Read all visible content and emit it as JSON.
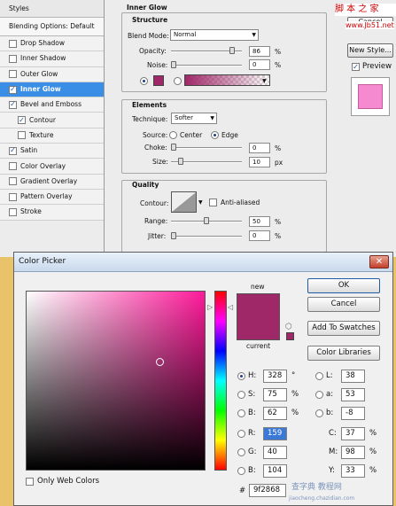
{
  "layer_style": {
    "header": "Styles",
    "blending_options": "Blending Options: Default",
    "items": [
      {
        "label": "Drop Shadow",
        "checked": false,
        "selected": false,
        "sub": false
      },
      {
        "label": "Inner Shadow",
        "checked": false,
        "selected": false,
        "sub": false
      },
      {
        "label": "Outer Glow",
        "checked": false,
        "selected": false,
        "sub": false
      },
      {
        "label": "Inner Glow",
        "checked": true,
        "selected": true,
        "sub": false
      },
      {
        "label": "Bevel and Emboss",
        "checked": true,
        "selected": false,
        "sub": false
      },
      {
        "label": "Contour",
        "checked": true,
        "selected": false,
        "sub": true
      },
      {
        "label": "Texture",
        "checked": false,
        "selected": false,
        "sub": true
      },
      {
        "label": "Satin",
        "checked": true,
        "selected": false,
        "sub": false
      },
      {
        "label": "Color Overlay",
        "checked": false,
        "selected": false,
        "sub": false
      },
      {
        "label": "Gradient Overlay",
        "checked": false,
        "selected": false,
        "sub": false
      },
      {
        "label": "Pattern Overlay",
        "checked": false,
        "selected": false,
        "sub": false
      },
      {
        "label": "Stroke",
        "checked": false,
        "selected": false,
        "sub": false
      }
    ]
  },
  "inner_glow": {
    "title": "Inner Glow",
    "structure": {
      "title": "Structure",
      "blend_mode_label": "Blend Mode:",
      "blend_mode": "Normal",
      "opacity_label": "Opacity:",
      "opacity": "86",
      "opacity_unit": "%",
      "opacity_level": 0.86,
      "noise_label": "Noise:",
      "noise": "0",
      "noise_unit": "%"
    },
    "elements": {
      "title": "Elements",
      "technique_label": "Technique:",
      "technique": "Softer",
      "source_label": "Source:",
      "center": "Center",
      "edge": "Edge",
      "choke_label": "Choke:",
      "choke": "0",
      "choke_unit": "%",
      "size_label": "Size:",
      "size": "10",
      "size_unit": "px"
    },
    "quality": {
      "title": "Quality",
      "contour_label": "Contour:",
      "anti_aliased": "Anti-aliased",
      "range_label": "Range:",
      "range": "50",
      "range_unit": "%",
      "jitter_label": "Jitter:",
      "jitter": "0",
      "jitter_unit": "%"
    }
  },
  "right_panel": {
    "cancel": "Cancel",
    "new_style": "New Style...",
    "preview": "Preview",
    "watermark": "脚 本 之 家",
    "watermark_url": "www.Jb51.net"
  },
  "color_picker": {
    "title": "Color Picker",
    "ok": "OK",
    "cancel": "Cancel",
    "add_to_swatches": "Add To Swatches",
    "color_libraries": "Color Libraries",
    "new_label": "new",
    "current_label": "current",
    "only_web_colors": "Only Web Colors",
    "hex_label": "#",
    "hex": "9f2868",
    "color": "#9f2868",
    "hsb": [
      {
        "key": "H:",
        "value": "328",
        "unit": "°",
        "selected": true
      },
      {
        "key": "S:",
        "value": "75",
        "unit": "%",
        "selected": false
      },
      {
        "key": "B:",
        "value": "62",
        "unit": "%",
        "selected": false
      }
    ],
    "rgb": [
      {
        "key": "R:",
        "value": "159",
        "unit": ""
      },
      {
        "key": "G:",
        "value": "40",
        "unit": ""
      },
      {
        "key": "B:",
        "value": "104",
        "unit": ""
      }
    ],
    "lab": [
      {
        "key": "L:",
        "value": "38"
      },
      {
        "key": "a:",
        "value": "53"
      },
      {
        "key": "b:",
        "value": "-8"
      }
    ],
    "cmyk": [
      {
        "key": "C:",
        "value": "37",
        "unit": "%"
      },
      {
        "key": "M:",
        "value": "98",
        "unit": "%"
      },
      {
        "key": "Y:",
        "value": "33",
        "unit": "%"
      }
    ],
    "bottom_watermark": "查字典 教程网",
    "bottom_watermark_url": "jiaocheng.chazidian.com"
  }
}
